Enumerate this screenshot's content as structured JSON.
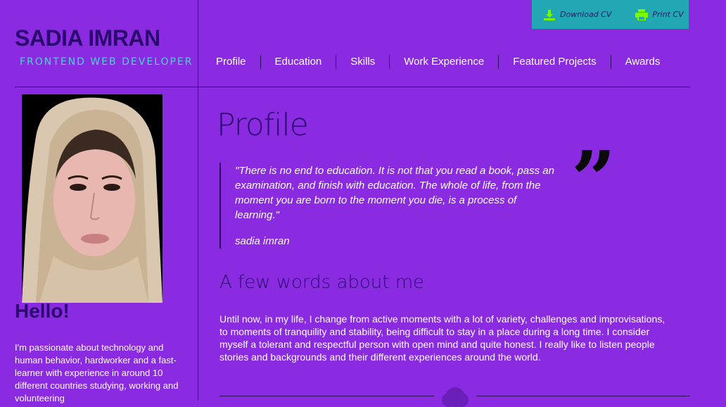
{
  "actions": {
    "download_label": "Download CV",
    "print_label": "Print CV",
    "icon_color": "#7cfc00"
  },
  "header": {
    "name": "SADIA IMRAN",
    "role": "FRONTEND WEB DEVELOPER"
  },
  "nav": {
    "items": [
      "Profile",
      "Education",
      "Skills",
      "Work Experience",
      "Featured Projects",
      "Awards"
    ]
  },
  "sidebar": {
    "greeting": "Hello!",
    "intro": "I'm passionate about technology and human behavior, hardworker and a fast-learner with experience in around 10 different countries studying, working and volunteering"
  },
  "main": {
    "title": "Profile",
    "quote": "\"There is no end to education. It is not that you read a book, pass an examination, and finish with education. The whole of life, from the moment you are born to the moment you die, is a process of learning.\"",
    "quote_author": "sadia imran",
    "quote_mark": "”",
    "subheading": "A few words about me",
    "about": "Until now, in my life, I change from active moments with a lot of variety, challenges and improvisations, to moments of tranquility and stability, being difficult to stay in a place during a long time. I consider myself a tolerant and respectful person with open mind and quite honest. I really like to listen people stories and backgrounds and their different experiences around the world."
  },
  "colors": {
    "background": "#8a2be2",
    "accent_bar": "#22a8b4",
    "dark_text": "#2a0a6e",
    "role_text": "#4fd1d9"
  }
}
